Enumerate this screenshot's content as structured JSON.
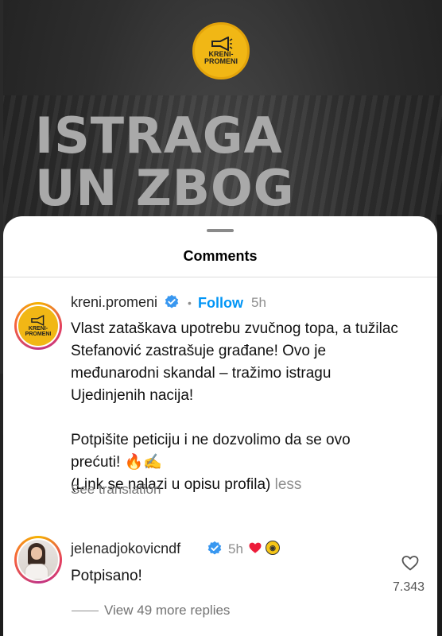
{
  "background": {
    "brand_logo_text": "KRENI-\nPROMENI",
    "headline_lines": [
      "ISTRAGA",
      "UN ZBOG"
    ]
  },
  "sheet": {
    "title": "Comments"
  },
  "comment": {
    "username": "kreni.promeni",
    "avatar_text": "KRENI-\nPROMENI",
    "verified_icon": "verified-badge-icon",
    "follow_label": "Follow",
    "separator": "•",
    "time": "5h",
    "lines": [
      "Vlast zataškava upotrebu zvučnog topa, a tužilac",
      "Stefanović zastrašuje građane! Ovo je",
      "međunarodni skandal – tražimo istragu",
      "Ujedinjenih nacija!",
      "",
      "Potpišite peticiju i ne dozvolimo da se ovo",
      "prećuti! 🔥✍",
      "(Link se nalazi u opisu profila)"
    ],
    "less_label": "less",
    "see_translation": "See translation"
  },
  "reply": {
    "username": "jelenadjokovicndf",
    "time": "5h",
    "creator_like_icon": "heart-icon",
    "creator_avatar_icon": "kreni-promeni-avatar-icon",
    "text": "Potpisano!",
    "like_count": "7.343",
    "view_replies": "View 49 more replies"
  },
  "colors": {
    "follow_blue": "#0095f6",
    "verified_blue": "#3897f0",
    "heart_red": "#ed1c3a",
    "brand_yellow": "#f1b715"
  }
}
